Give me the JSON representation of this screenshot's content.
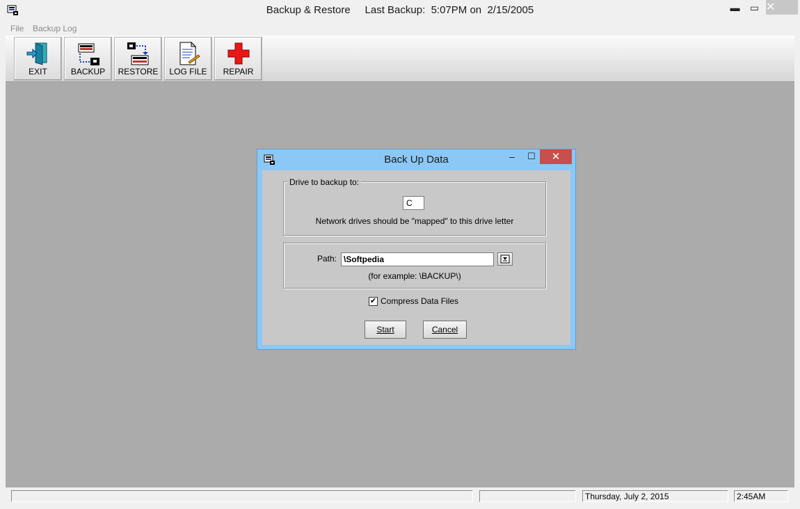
{
  "window": {
    "title": "Backup & Restore     Last Backup:  5:07PM on  2/15/2005",
    "min_glyph": "▬",
    "max_glyph": "▭",
    "close_glyph": "✕"
  },
  "menu": {
    "items": [
      {
        "label": "File"
      },
      {
        "label": "Backup Log"
      }
    ]
  },
  "toolbar": {
    "buttons": [
      {
        "label": "EXIT",
        "icon": "exit-door-icon"
      },
      {
        "label": "BACKUP",
        "icon": "backup-icon"
      },
      {
        "label": "RESTORE",
        "icon": "restore-icon"
      },
      {
        "label": "LOG FILE",
        "icon": "log-file-icon"
      },
      {
        "label": "REPAIR",
        "icon": "red-cross-icon"
      }
    ]
  },
  "dialog": {
    "title": "Back Up Data",
    "min_glyph": "–",
    "max_glyph": "☐",
    "close_glyph": "✕",
    "drive_group_label": "Drive to backup to:",
    "drive_value": "C",
    "drive_hint": "Network drives should be \"mapped\" to this drive letter",
    "path_label": "Path:",
    "path_value": "\\Softpedia",
    "path_hint": "(for example: \\BACKUP\\)",
    "compress_label": "Compress Data Files",
    "compress_checked": true,
    "check_glyph": "✔",
    "start_label": "Start",
    "cancel_label": "Cancel"
  },
  "status": {
    "date": "Thursday, July  2, 2015",
    "time": "2:45AM"
  },
  "colors": {
    "dialog_frame": "#8cc8f6",
    "dialog_close": "#c74f4c",
    "client_bg": "#ababab"
  }
}
